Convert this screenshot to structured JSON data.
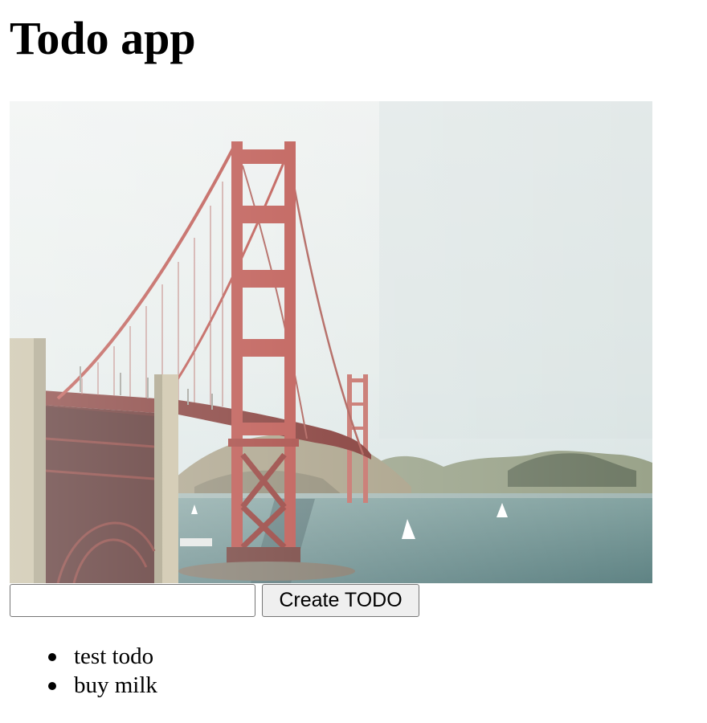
{
  "header": {
    "title": "Todo app"
  },
  "hero_image": {
    "subject": "golden-gate-bridge"
  },
  "form": {
    "input_value": "",
    "input_placeholder": "",
    "button_label": "Create TODO"
  },
  "todos": [
    {
      "text": "test todo"
    },
    {
      "text": "buy milk"
    }
  ],
  "colors": {
    "background": "#ffffff",
    "text": "#000000",
    "button_bg": "#efefef",
    "control_border": "#767676",
    "bridge_red": "#b84a43"
  }
}
